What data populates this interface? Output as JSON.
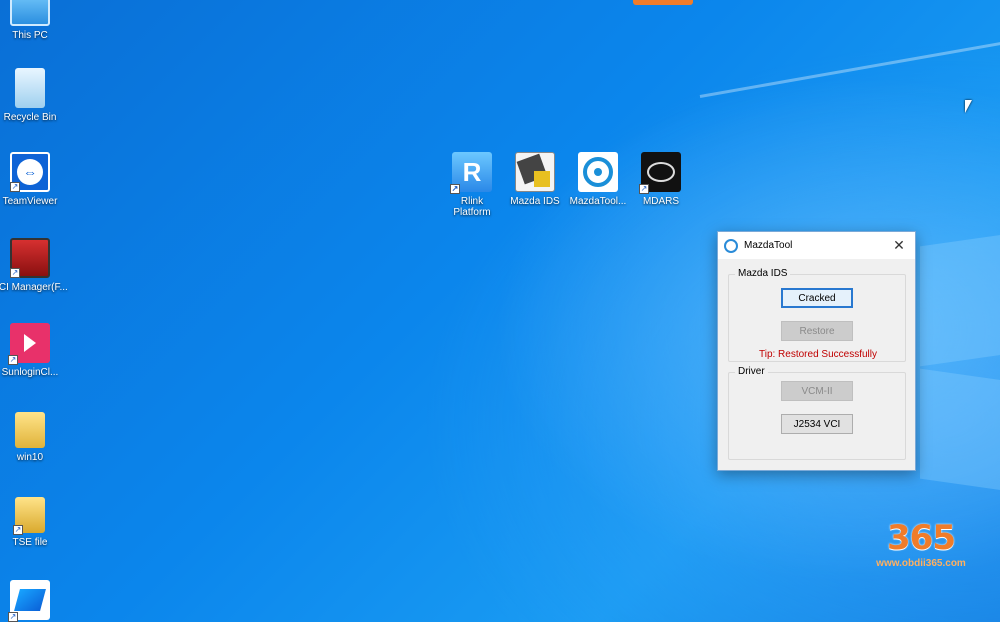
{
  "desktop": {
    "left_icons": [
      {
        "label": "This PC",
        "icon": "this-pc-icon"
      },
      {
        "label": "Recycle Bin",
        "icon": "recycle-bin-icon"
      },
      {
        "label": "TeamViewer",
        "icon": "teamviewer-icon"
      },
      {
        "label": "VCI Manager(F...",
        "icon": "vci-manager-icon"
      },
      {
        "label": "SunloginCl...",
        "icon": "sunlogin-icon"
      },
      {
        "label": "win10",
        "icon": "folder-icon"
      },
      {
        "label": "TSE file",
        "icon": "folder-icon"
      },
      {
        "label": "",
        "icon": "app-shortcut-icon"
      }
    ],
    "center_icons": [
      {
        "label": "Rlink Platform",
        "icon": "rlink-icon",
        "glyph": "R"
      },
      {
        "label": "Mazda IDS",
        "icon": "mazda-ids-icon"
      },
      {
        "label": "MazdaTool...",
        "icon": "mazdatool-icon"
      },
      {
        "label": "MDARS",
        "icon": "mdars-icon"
      }
    ]
  },
  "dialog": {
    "title": "MazdaTool",
    "close_glyph": "✕",
    "group_mazda": {
      "legend": "Mazda IDS",
      "cracked_label": "Cracked",
      "restore_label": "Restore",
      "tip": "Tip: Restored Successfully"
    },
    "group_driver": {
      "legend": "Driver",
      "vcm_label": "VCM-II",
      "j2534_label": "J2534 VCI"
    }
  },
  "watermark": {
    "digits": "365",
    "url": "www.obdii365.com"
  },
  "colors": {
    "desktop_blue": "#0b86ec",
    "tip_red": "#c00000",
    "watermark_orange": "#f07c2a"
  }
}
